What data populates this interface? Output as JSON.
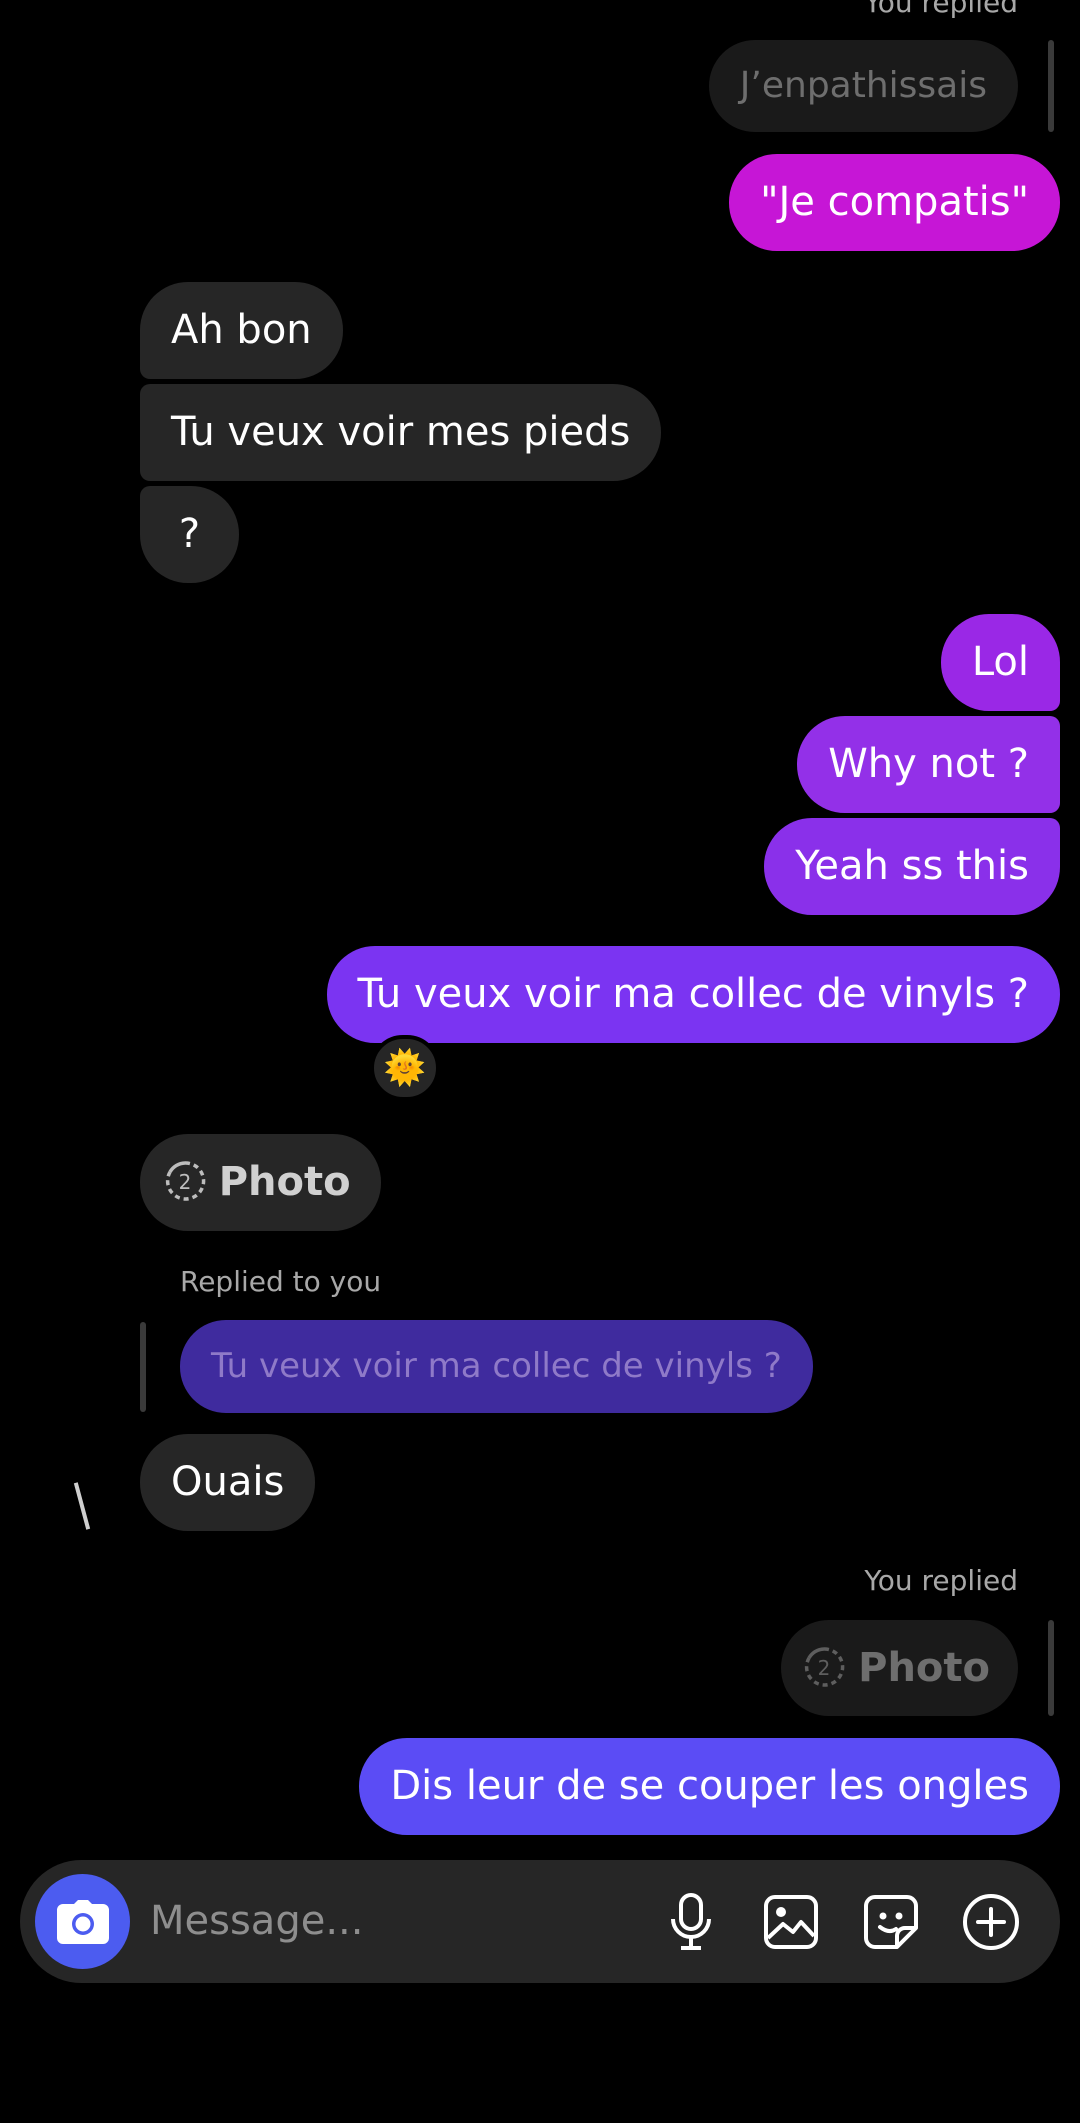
{
  "thread": {
    "replied_header_top": "You replied",
    "quoted_top": "J’enpathissais",
    "msg_compatis": "\"Je compatis\"",
    "in_ah_bon": "Ah bon",
    "in_pieds": "Tu veux voir mes pieds",
    "in_question": "?",
    "out_lol": "Lol",
    "out_why_not": "Why not ?",
    "out_yeah": "Yeah ss this",
    "out_vinyls": "Tu veux voir ma collec de vinyls ?",
    "reaction_emoji": "🌞",
    "in_photo_label": "Photo",
    "in_photo_count": "2",
    "replied_to_you": "Replied to you",
    "quoted_vinyls": "Tu veux voir ma collec de vinyls ?",
    "in_ouais": "Ouais",
    "replied_header_bottom": "You replied",
    "quoted_photo_label": "Photo",
    "quoted_photo_count": "2",
    "out_ongles": "Dis leur de se couper les ongles"
  },
  "composer": {
    "placeholder": "Message..."
  },
  "icons": {
    "camera": "camera-icon",
    "mic": "microphone-icon",
    "gallery": "image-icon",
    "sticker": "sticker-icon",
    "plus": "plus-circle-icon",
    "view_once": "view-once-icon"
  },
  "colors": {
    "incoming_bubble": "#262626",
    "outgoing_magenta": "#c616d6",
    "outgoing_purple_1": "#9a28e6",
    "outgoing_purple_2": "#7b34f2",
    "outgoing_indigo": "#5b4cf5",
    "camera_button": "#4c5cf0"
  }
}
